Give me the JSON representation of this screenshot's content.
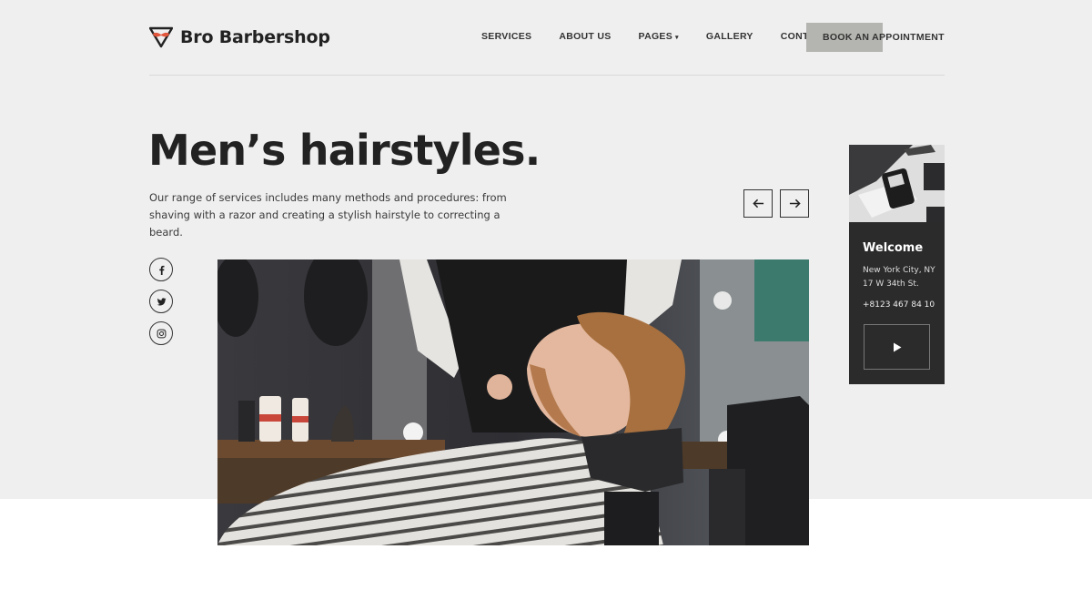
{
  "brand": {
    "name": "Bro Barbershop",
    "accent": "#e2563b"
  },
  "nav": {
    "items": [
      "SERVICES",
      "ABOUT US",
      "PAGES",
      "GALLERY",
      "CONTACTS"
    ],
    "pages_caret": "▾",
    "cta": "BOOK AN APPOINTMENT"
  },
  "hero": {
    "title": "Men’s hairstyles.",
    "description": "Our range of services includes many methods and procedures: from shaving with a razor and creating a stylish hairstyle to correcting a beard.",
    "prev_icon": "arrow-left-icon",
    "next_icon": "arrow-right-icon"
  },
  "social": [
    "facebook-icon",
    "twitter-icon",
    "instagram-icon"
  ],
  "card": {
    "title": "Welcome",
    "address": "New York City, NY 17 W 34th St.",
    "phone": "+8123 467 84 10",
    "play_icon": "play-icon"
  },
  "colors": {
    "hero_bg": "#efefef",
    "card_bg": "#2b2b2b",
    "cta_bg": "#b4b4b0",
    "text": "#222222"
  }
}
